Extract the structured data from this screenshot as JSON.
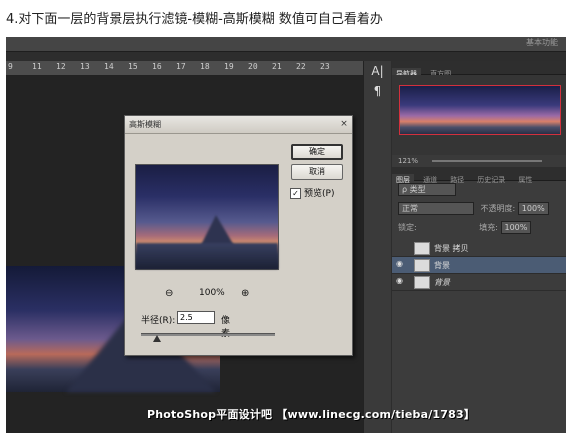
{
  "caption": "4.对下面一层的背景层执行滤镜-模糊-高斯模糊 数值可自己看着办",
  "topbar": {
    "right_label": "基本功能"
  },
  "ruler": {
    "ticks": [
      "9",
      "11",
      "12",
      "13",
      "14",
      "15",
      "16",
      "17",
      "18",
      "19",
      "20",
      "21",
      "22",
      "23"
    ]
  },
  "tools": {
    "items": [
      "A|",
      "¶"
    ]
  },
  "panel": {
    "nav_tabs": [
      "导航器",
      "直方图"
    ],
    "zoom": "121%",
    "layers_tabs": [
      "图层",
      "通道",
      "路径",
      "历史记录",
      "属性"
    ],
    "kind_label": "ρ 类型",
    "blend_mode": "正常",
    "opacity_label": "不透明度:",
    "opacity_value": "100%",
    "lock_label": "锁定:",
    "fill_label": "填充:",
    "fill_value": "100%",
    "layers": [
      {
        "name": "背景 拷贝",
        "visible": false,
        "selected": false
      },
      {
        "name": "背景",
        "visible": true,
        "selected": true
      },
      {
        "name": "背景",
        "visible": true,
        "selected": false
      }
    ]
  },
  "dialog": {
    "title": "高斯模糊",
    "close": "×",
    "ok_label": "确定",
    "cancel_label": "取消",
    "preview_label": "预览(P)",
    "preview_checked": "✓",
    "zoom_out": "⊖",
    "zoom_in": "⊕",
    "zoom_percent": "100%",
    "radius_label": "半径(R):",
    "radius_value": "2.5",
    "radius_unit": "像素",
    "radius_slider_fraction": 0.12
  },
  "watermark": "PhotoShop平面设计吧 【www.linecg.com/tieba/1783】"
}
